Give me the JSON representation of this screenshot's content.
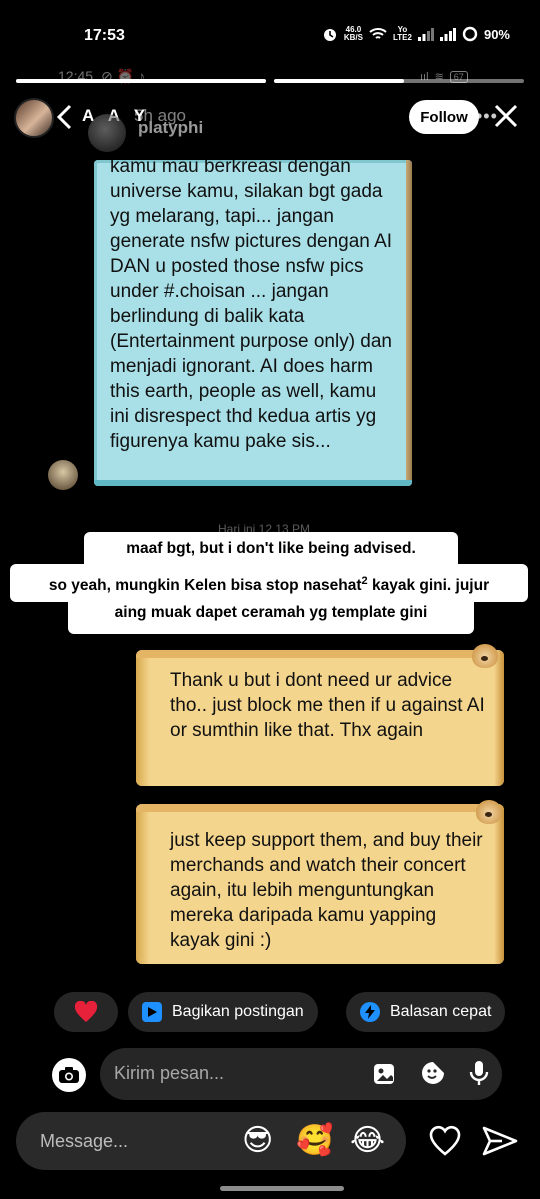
{
  "status_bar": {
    "time": "17:53",
    "net_speed_top": "46.0",
    "net_speed_bottom": "KB/S",
    "volte_top": "Yo",
    "volte_bottom": "LTE2",
    "battery": "90%"
  },
  "background_status": {
    "time": "12:45",
    "battery": "67"
  },
  "story": {
    "progress_fraction": 0.52,
    "user": "A A Y",
    "time_ago": "5h ago",
    "follow_label": "Follow",
    "background_username": "platyphi",
    "background_date": "Hari ini 12.13 PM"
  },
  "teal_message": "kamu mau berkreasi dengan universe kamu, silakan bgt gada yg melarang, tapi... jangan generate nsfw pictures dengan AI DAN u posted those nsfw pics under #.choisan ... jangan berlindung di balik kata (Entertainment purpose only) dan menjadi ignorant. AI does harm this earth, people as well, kamu ini disrespect thd kedua artis yg figurenya kamu pake sis...",
  "caption": {
    "line1": "maaf bgt, but i don't like being advised.",
    "line2_a": "so yeah, mungkin Kelen bisa stop nasehat",
    "line2_sup": "2",
    "line2_b": " kayak gini. jujur",
    "line3": "aing muak dapet ceramah yg template gini"
  },
  "scroll_messages": [
    "Thank u but i dont need ur advice tho.. just block me then if u against AI or sumthin like that. Thx again",
    "just keep support them, and buy their merchands and watch their concert again, itu lebih menguntungkan mereka daripada kamu yapping kayak gini :)"
  ],
  "chips": {
    "share_post": "Bagikan postingan",
    "quick_reply": "Balasan cepat"
  },
  "dm_input_placeholder": "Kirim pesan...",
  "reply_placeholder": "Message...",
  "reaction_emojis": [
    "😎",
    "🥰",
    "😂"
  ],
  "colors": {
    "teal_bubble": "#a9dfe6",
    "scroll_paper": "#f4d58d",
    "chip_bg": "#262626",
    "share_icon": "#1e90ff",
    "heart": "#e8213a"
  }
}
